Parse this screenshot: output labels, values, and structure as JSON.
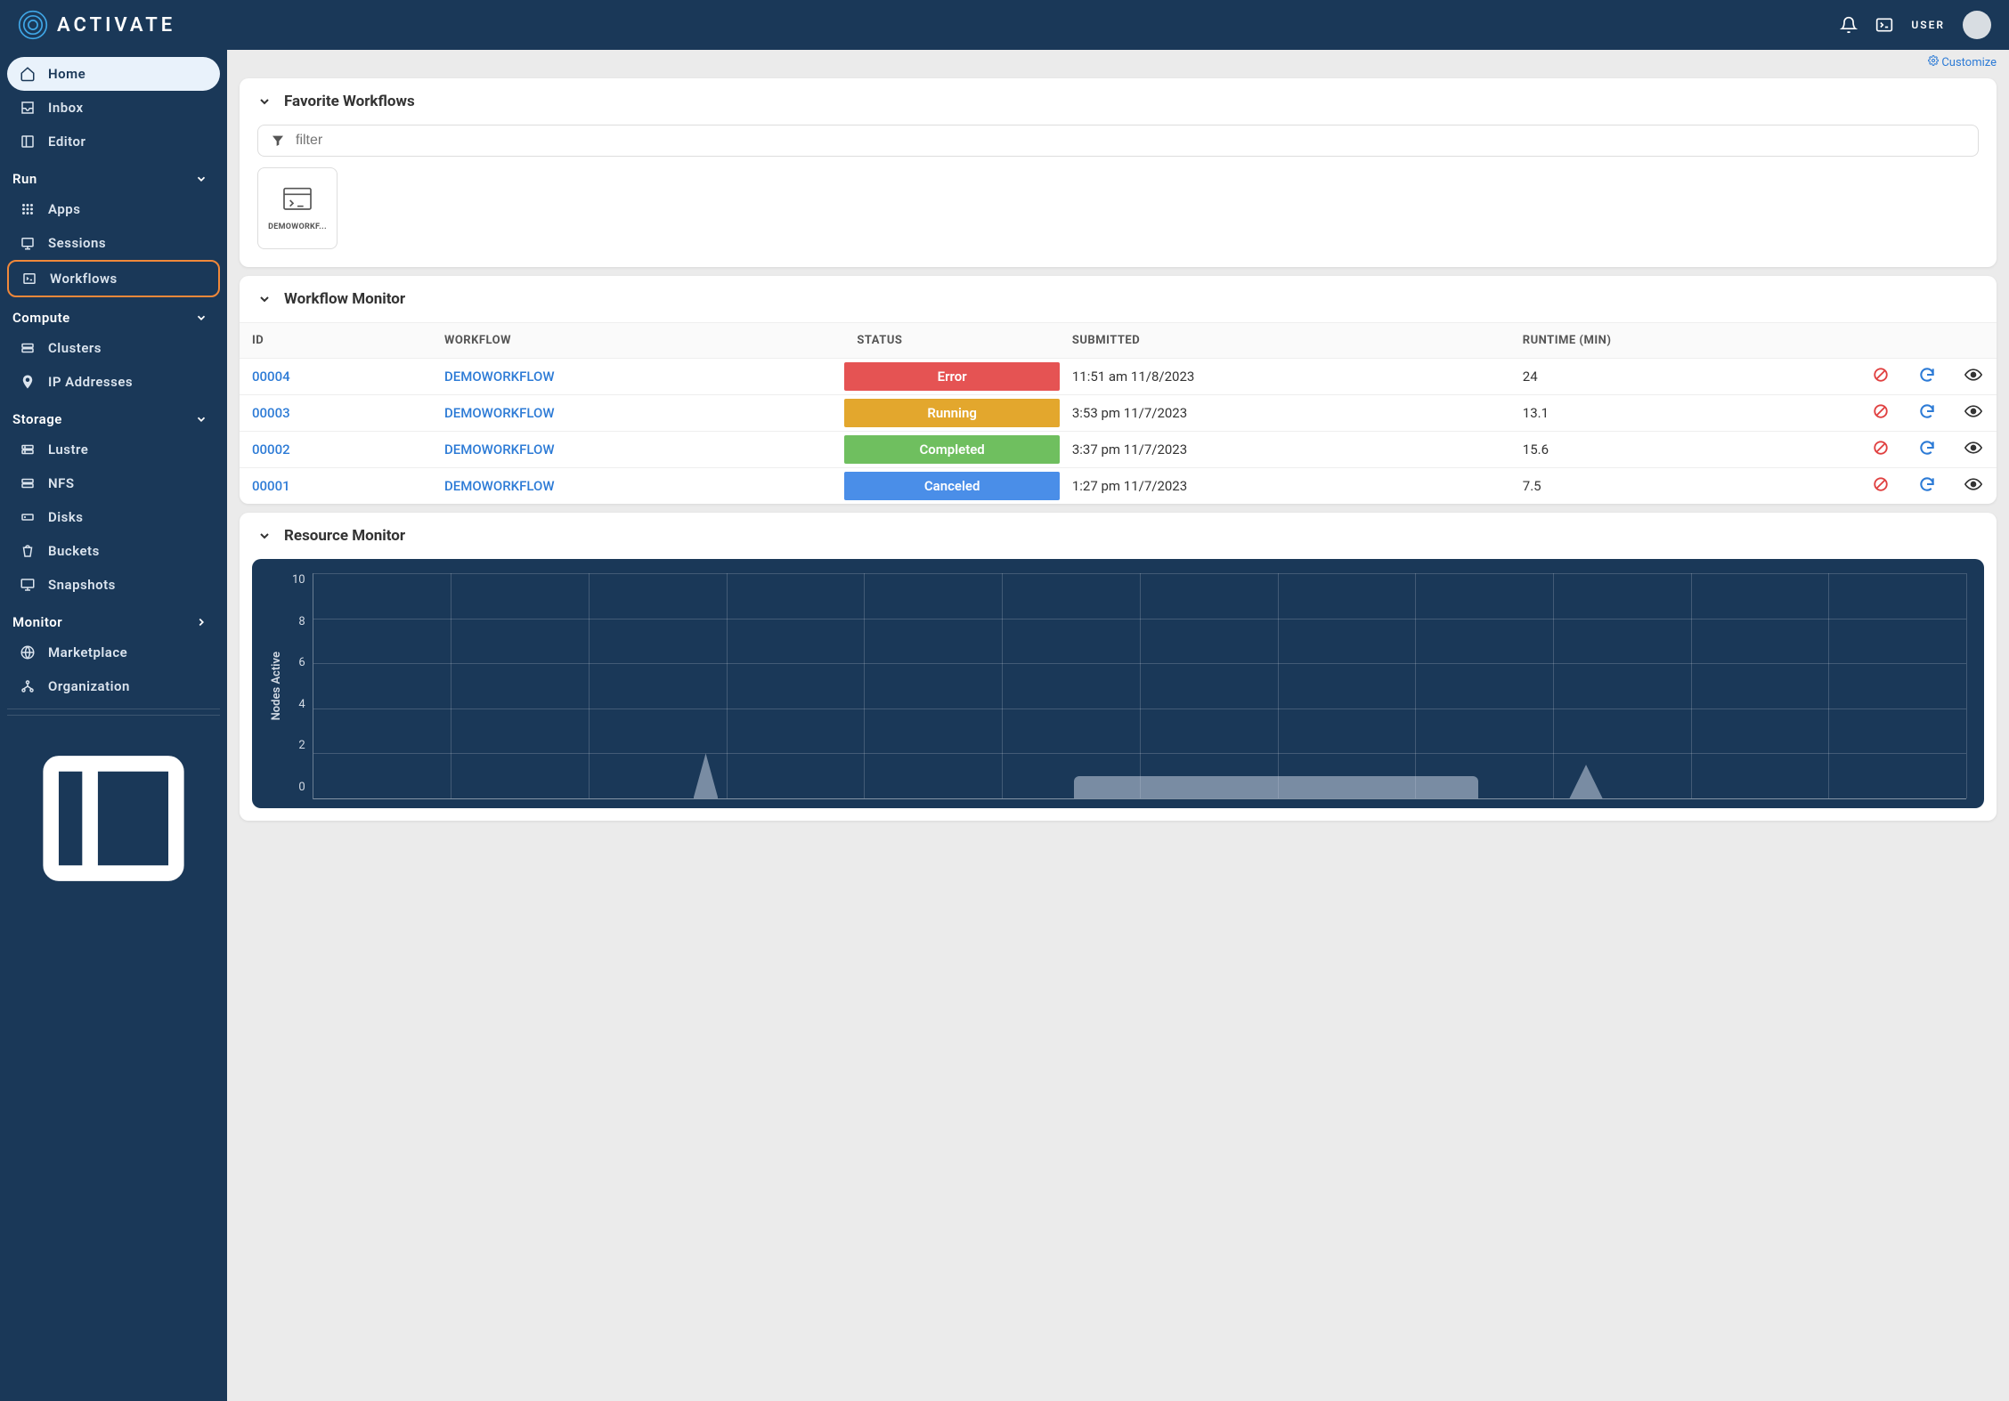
{
  "header": {
    "brand": "ACTIVATE",
    "user_label": "USER"
  },
  "sidebar": {
    "top": [
      {
        "label": "Home",
        "icon": "home",
        "active": true
      },
      {
        "label": "Inbox",
        "icon": "inbox"
      },
      {
        "label": "Editor",
        "icon": "editor"
      }
    ],
    "sections": {
      "run": {
        "label": "Run",
        "items": [
          {
            "label": "Apps",
            "icon": "apps"
          },
          {
            "label": "Sessions",
            "icon": "sessions"
          },
          {
            "label": "Workflows",
            "icon": "workflows",
            "highlighted": true
          }
        ]
      },
      "compute": {
        "label": "Compute",
        "items": [
          {
            "label": "Clusters",
            "icon": "clusters"
          },
          {
            "label": "IP Addresses",
            "icon": "ip"
          }
        ]
      },
      "storage": {
        "label": "Storage",
        "items": [
          {
            "label": "Lustre",
            "icon": "drive"
          },
          {
            "label": "NFS",
            "icon": "drive"
          },
          {
            "label": "Disks",
            "icon": "drive"
          },
          {
            "label": "Buckets",
            "icon": "bucket"
          },
          {
            "label": "Snapshots",
            "icon": "monitor2"
          }
        ]
      },
      "monitor": {
        "label": "Monitor",
        "right": true,
        "items": [
          {
            "label": "Marketplace",
            "icon": "globe"
          },
          {
            "label": "Organization",
            "icon": "org"
          }
        ]
      }
    }
  },
  "customize_label": "Customize",
  "favorites": {
    "title": "Favorite Workflows",
    "filter_placeholder": "filter",
    "cards": [
      {
        "label": "DEMOWORKF..."
      }
    ]
  },
  "monitor_panel": {
    "title": "Workflow Monitor",
    "headers": {
      "id": "ID",
      "workflow": "WORKFLOW",
      "status": "STATUS",
      "submitted": "SUBMITTED",
      "runtime": "RUNTIME (MIN)"
    },
    "rows": [
      {
        "id": "00004",
        "workflow": "DEMOWORKFLOW",
        "status": "Error",
        "status_class": "status-error",
        "submitted": "11:51 am 11/8/2023",
        "runtime": "24"
      },
      {
        "id": "00003",
        "workflow": "DEMOWORKFLOW",
        "status": "Running",
        "status_class": "status-running",
        "submitted": "3:53 pm 11/7/2023",
        "runtime": "13.1"
      },
      {
        "id": "00002",
        "workflow": "DEMOWORKFLOW",
        "status": "Completed",
        "status_class": "status-completed",
        "submitted": "3:37 pm 11/7/2023",
        "runtime": "15.6"
      },
      {
        "id": "00001",
        "workflow": "DEMOWORKFLOW",
        "status": "Canceled",
        "status_class": "status-canceled",
        "submitted": "1:27 pm 11/7/2023",
        "runtime": "7.5"
      }
    ]
  },
  "resource": {
    "title": "Resource Monitor",
    "ylabel": "Nodes Active",
    "yticks": [
      "10",
      "8",
      "6",
      "4",
      "2",
      "0"
    ]
  },
  "chart_data": {
    "type": "area",
    "ylabel": "Nodes Active",
    "ylim": [
      0,
      10
    ],
    "yticks": [
      0,
      2,
      4,
      6,
      8,
      10
    ],
    "x_range_pct": [
      0,
      100
    ],
    "series": [
      {
        "name": "Nodes Active",
        "segments": [
          {
            "start_pct": 23,
            "end_pct": 24.5,
            "peak_value": 2
          },
          {
            "start_pct": 46,
            "end_pct": 70.5,
            "peak_value": 1
          },
          {
            "start_pct": 76,
            "end_pct": 78,
            "peak_value": 1.5
          }
        ]
      }
    ]
  }
}
